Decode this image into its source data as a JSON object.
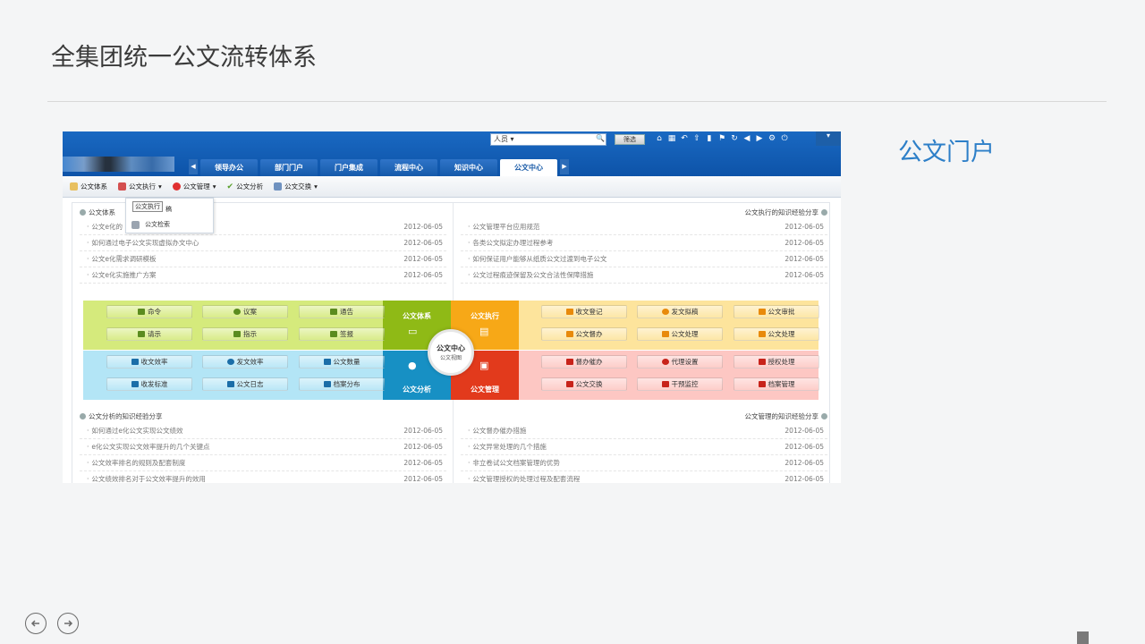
{
  "slide": {
    "title": "全集团统一公文流转体系",
    "side_label": "公文门户"
  },
  "colors": {
    "accent_blue": "#2d7fc8",
    "top_bar": "#1a69c2",
    "zone_green": "#d5ea7c",
    "zone_cyan": "#b3e5f6",
    "zone_yellow": "#fde49c",
    "zone_pink": "#fdc7c3"
  },
  "app": {
    "search_value": "人员",
    "search_button": "筛选",
    "tabs": [
      "领导办公",
      "部门门户",
      "门户集成",
      "流程中心",
      "知识中心",
      "公文中心"
    ],
    "active_tab": "公文中心",
    "toolbar": [
      "公文体系",
      "公文执行",
      "公文管理",
      "公文分析",
      "公文交换"
    ],
    "dropdown": {
      "header": "公文执行",
      "item_a": "稿",
      "item_b": "公文检索"
    },
    "panels": {
      "tl_title": "公文体系",
      "tr_title": "公文执行的知识经验分享",
      "bl_title": "公文分析的知识经验分享",
      "br_title": "公文管理的知识经验分享"
    },
    "tl_rows": [
      {
        "t": "公文e化的",
        "d": "2012-06-05"
      },
      {
        "t": "如何通过电子公文实现虚拟办文中心",
        "d": "2012-06-05"
      },
      {
        "t": "公文e化需求调研模板",
        "d": "2012-06-05"
      },
      {
        "t": "公文e化实施推广方案",
        "d": "2012-06-05"
      }
    ],
    "tr_rows": [
      {
        "t": "公文管理平台应用规范",
        "d": "2012-06-05"
      },
      {
        "t": "各类公文拟定办理过程参考",
        "d": "2012-06-05"
      },
      {
        "t": "如何保证用户能够从纸质公文过渡到电子公文",
        "d": "2012-06-05"
      },
      {
        "t": "公文过程痕迹保留及公文合法性保障措施",
        "d": "2012-06-05"
      }
    ],
    "bl_rows": [
      {
        "t": "如何通过e化公文实现公文绩效",
        "d": "2012-06-05"
      },
      {
        "t": "e化公文实现公文效率提升的几个关键点",
        "d": "2012-06-05"
      },
      {
        "t": "公文效率排名的规则及配套制度",
        "d": "2012-06-05"
      },
      {
        "t": "公文绩效排名对于公文效率提升的效用",
        "d": "2012-06-05"
      }
    ],
    "br_rows": [
      {
        "t": "公文督办催办措施",
        "d": "2012-06-05"
      },
      {
        "t": "公文异常处理的几个措施",
        "d": "2012-06-05"
      },
      {
        "t": "非立卷试公文档案管理的优势",
        "d": "2012-06-05"
      },
      {
        "t": "公文管理授权的处理过程及配套流程",
        "d": "2012-06-05"
      }
    ],
    "hub": {
      "h1": "公文体系",
      "h2": "公文执行",
      "h3": "公文分析",
      "h4": "公文管理",
      "center": "公文中心",
      "center_sub": "公文视图"
    },
    "green_btns": [
      "命令",
      "议案",
      "通告",
      "请示",
      "指示",
      "签报"
    ],
    "cyan_btns": [
      "收文效率",
      "发文效率",
      "公文数量",
      "收发标准",
      "公文日志",
      "档案分布"
    ],
    "yellow_btns": [
      "收文登记",
      "发文拟稿",
      "公文审批",
      "公文督办",
      "公文处理",
      "公文处理"
    ],
    "pink_btns": [
      "督办催办",
      "代理设置",
      "授权处理",
      "公文交换",
      "干预监控",
      "档案管理"
    ]
  }
}
